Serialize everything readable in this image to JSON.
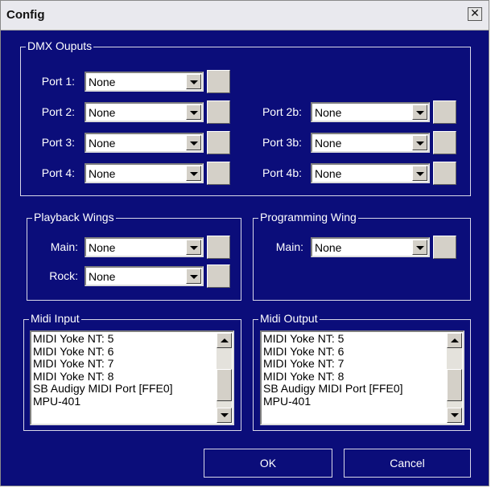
{
  "window": {
    "title": "Config",
    "close_glyph": "✕"
  },
  "dmx": {
    "legend": "DMX Ouputs",
    "ports": [
      {
        "label": "Port 1:",
        "value": "None"
      },
      {
        "label": "Port 2:",
        "value": "None"
      },
      {
        "label": "Port 3:",
        "value": "None"
      },
      {
        "label": "Port 4:",
        "value": "None"
      },
      {
        "label": "Port 2b:",
        "value": "None"
      },
      {
        "label": "Port 3b:",
        "value": "None"
      },
      {
        "label": "Port 4b:",
        "value": "None"
      }
    ]
  },
  "playback_wings": {
    "legend": "Playback Wings",
    "main_label": "Main:",
    "main_value": "None",
    "rock_label": "Rock:",
    "rock_value": "None"
  },
  "programming_wing": {
    "legend": "Programming Wing",
    "main_label": "Main:",
    "main_value": "None"
  },
  "midi_input": {
    "legend": "Midi Input",
    "items": [
      "MIDI Yoke NT:  5",
      "MIDI Yoke NT:  6",
      "MIDI Yoke NT:  7",
      "MIDI Yoke NT:  8",
      "SB Audigy MIDI Port [FFE0]",
      "MPU-401"
    ]
  },
  "midi_output": {
    "legend": "Midi Output",
    "items": [
      "MIDI Yoke NT:  5",
      "MIDI Yoke NT:  6",
      "MIDI Yoke NT:  7",
      "MIDI Yoke NT:  8",
      "SB Audigy MIDI Port [FFE0]",
      "MPU-401"
    ]
  },
  "buttons": {
    "ok": "OK",
    "cancel": "Cancel"
  },
  "colors": {
    "background": "#0b0d7a",
    "text": "#ffffff",
    "control_face": "#d4d0c8"
  },
  "icons": {
    "close": "close-icon",
    "dropdown": "chevron-down-icon",
    "scroll_up": "scroll-up-icon",
    "scroll_down": "scroll-down-icon"
  }
}
